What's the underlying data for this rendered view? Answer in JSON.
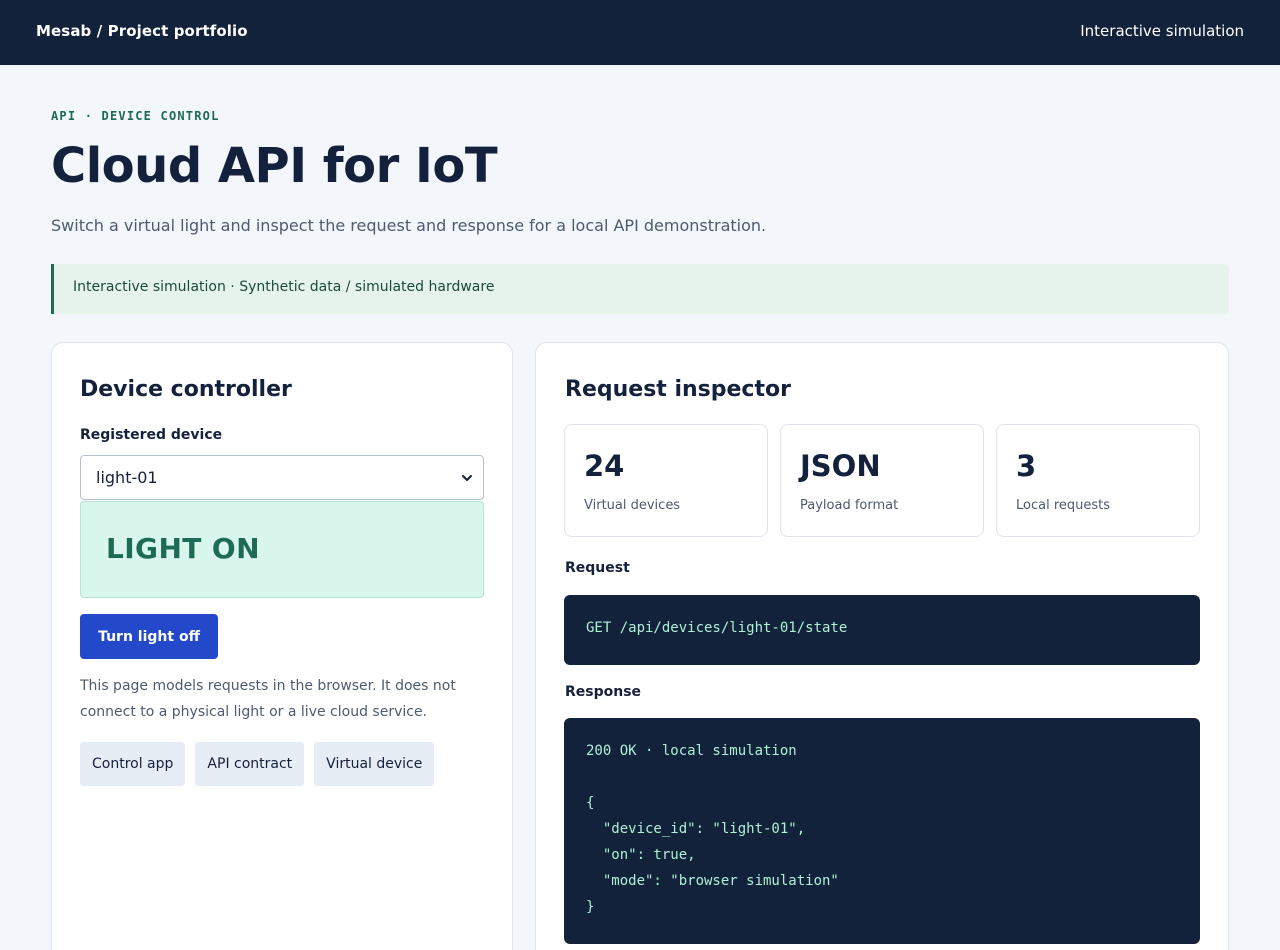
{
  "header": {
    "brand": "Mesab / Project portfolio",
    "mode": "Interactive simulation"
  },
  "hero": {
    "eyebrow": "API · DEVICE CONTROL",
    "title": "Cloud API for IoT",
    "subtitle": "Switch a virtual light and inspect the request and response for a local API demonstration."
  },
  "notice": {
    "text": "Interactive simulation · Synthetic data / simulated hardware"
  },
  "controller": {
    "title": "Device controller",
    "device_label": "Registered device",
    "selected_device": "light-01",
    "light_status": "LIGHT ON",
    "toggle_label": "Turn light off",
    "help_text": "This page models requests in the browser. It does not connect to a physical light or a live cloud service.",
    "chips": [
      "Control app",
      "API contract",
      "Virtual device"
    ]
  },
  "inspector": {
    "title": "Request inspector",
    "stats": [
      {
        "value": "24",
        "label": "Virtual devices"
      },
      {
        "value": "JSON",
        "label": "Payload format"
      },
      {
        "value": "3",
        "label": "Local requests"
      }
    ],
    "request_label": "Request",
    "request_line": "GET /api/devices/light-01/state",
    "response_label": "Response",
    "response_status": "200 OK · local simulation",
    "response_body": [
      "{",
      "  \"device_id\": \"light-01\",",
      "  \"on\": true,",
      "  \"mode\": \"browser simulation\"",
      "}"
    ]
  },
  "icons": {
    "select_arrow": "chevron-down-icon"
  },
  "colors": {
    "nav_bg": "#13223b",
    "accent_green": "#1d6b55",
    "light_on_bg": "#d8f6ec",
    "primary_button": "#2348c9",
    "code_bg": "#13223b",
    "code_text": "#aef0d6"
  }
}
